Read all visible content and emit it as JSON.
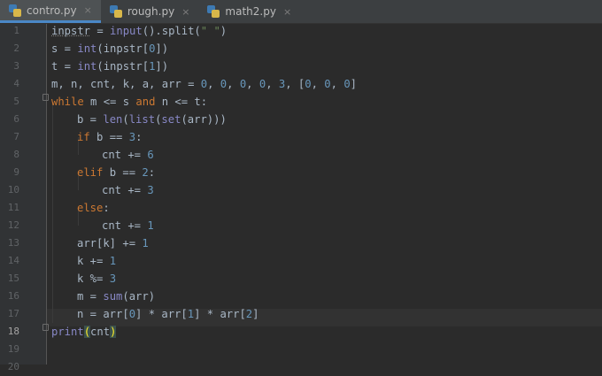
{
  "tabs": [
    {
      "label": "contro.py",
      "icon": "python-file-icon",
      "active": true
    },
    {
      "label": "rough.py",
      "icon": "python-file-icon",
      "active": false
    },
    {
      "label": "math2.py",
      "icon": "python-file-icon",
      "active": false
    }
  ],
  "close_glyph": "×",
  "line_numbers": [
    "1",
    "2",
    "3",
    "4",
    "5",
    "6",
    "7",
    "8",
    "9",
    "10",
    "11",
    "12",
    "13",
    "14",
    "15",
    "16",
    "17",
    "18",
    "19",
    "20"
  ],
  "current_line": "18",
  "colors": {
    "background": "#2b2b2b",
    "keyword": "#cc7832",
    "number": "#6897bb",
    "builtin": "#8888c6",
    "string": "#6a8759",
    "text": "#a9b7c6"
  },
  "code": {
    "l1": {
      "a": "inpstr",
      "b": " = ",
      "c": "input",
      "d": "().split(",
      "e": "\" \"",
      "f": ")"
    },
    "l2": {
      "a": "s = ",
      "b": "int",
      "c": "(inpstr[",
      "d": "0",
      "e": "])"
    },
    "l3": {
      "a": "t = ",
      "b": "int",
      "c": "(inpstr[",
      "d": "1",
      "e": "])"
    },
    "l4": {
      "a": "m, n, cnt, k, a, arr = ",
      "n1": "0",
      "s1": ", ",
      "n2": "0",
      "s2": ", ",
      "n3": "0",
      "s3": ", ",
      "n4": "0",
      "s4": ", ",
      "n5": "3",
      "s5": ", [",
      "n6": "0",
      "s6": ", ",
      "n7": "0",
      "s7": ", ",
      "n8": "0",
      "s8": "]"
    },
    "l5": {
      "a": "while",
      "b": " m <= s ",
      "c": "and",
      "d": " n <= t:"
    },
    "l6": {
      "a": "b = ",
      "b": "len",
      "c": "(",
      "d": "list",
      "e": "(",
      "f": "set",
      "g": "(arr)))"
    },
    "l7": {
      "a": "if",
      "b": " b == ",
      "c": "3",
      "d": ":"
    },
    "l8": {
      "a": "cnt += ",
      "b": "6"
    },
    "l9": {
      "a": "elif",
      "b": " b == ",
      "c": "2",
      "d": ":"
    },
    "l10": {
      "a": "cnt += ",
      "b": "3"
    },
    "l11": {
      "a": "else",
      "b": ":"
    },
    "l12": {
      "a": "cnt += ",
      "b": "1"
    },
    "l13": {
      "a": "arr[k] += ",
      "b": "1"
    },
    "l14": {
      "a": "k += ",
      "b": "1"
    },
    "l15": {
      "a": "k %= ",
      "b": "3"
    },
    "l16": {
      "a": "m = ",
      "b": "sum",
      "c": "(arr)"
    },
    "l17": {
      "a": "n = arr[",
      "b": "0",
      "c": "] * arr[",
      "d": "1",
      "e": "] * arr[",
      "f": "2",
      "g": "]"
    },
    "l18": {
      "a": "print",
      "b": "(",
      "c": "cnt",
      "d": ")"
    }
  }
}
